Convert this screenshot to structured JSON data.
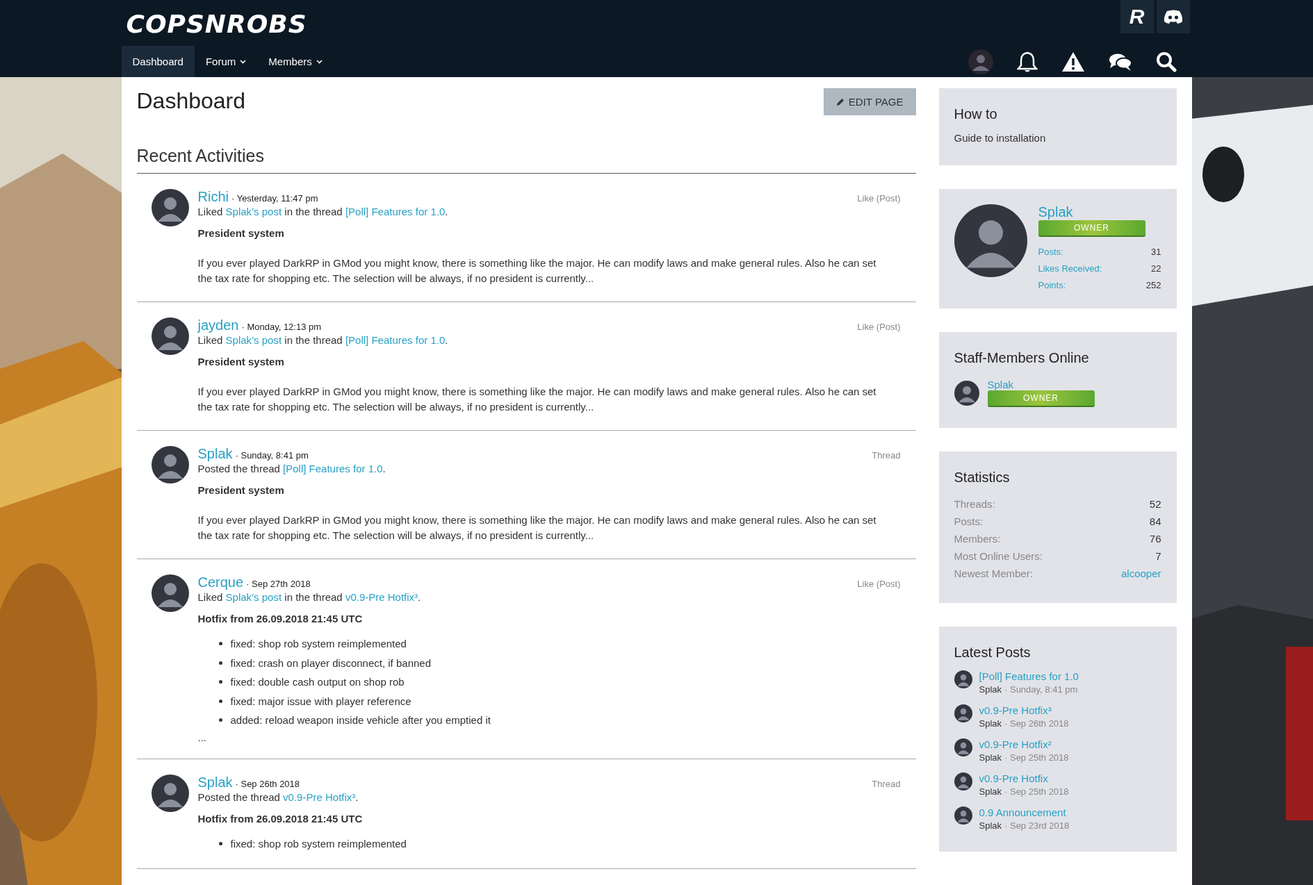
{
  "header": {
    "logo": "COPSNROBS",
    "top_buttons": [
      {
        "kind": "letter",
        "label": "R"
      },
      {
        "kind": "controller"
      }
    ],
    "nav": [
      {
        "label": "Dashboard",
        "selected": true,
        "dropdown": false
      },
      {
        "label": "Forum",
        "selected": false,
        "dropdown": true
      },
      {
        "label": "Members",
        "selected": false,
        "dropdown": true
      }
    ]
  },
  "page": {
    "title": "Dashboard",
    "edit_button": "EDIT PAGE",
    "section_title": "Recent Activities"
  },
  "activities": [
    {
      "user": "Richi",
      "time": "· Yesterday, 11:47 pm",
      "type": "Like (Post)",
      "action": [
        {
          "kind": "text",
          "text": "Liked "
        },
        {
          "kind": "link",
          "text": "Splak’s post"
        },
        {
          "kind": "text",
          "text": " in the thread "
        },
        {
          "kind": "link",
          "text": "[Poll] Features for 1.0"
        },
        {
          "kind": "text",
          "text": "."
        }
      ],
      "title": "President system",
      "excerpt": "If you ever played DarkRP in GMod you might know, there is something like the major. He can modify laws and make general rules. Also he can set the tax rate for shopping etc. The selection will be always, if no president is currently..."
    },
    {
      "user": "jayden",
      "time": "· Monday, 12:13 pm",
      "type": "Like (Post)",
      "action": [
        {
          "kind": "text",
          "text": "Liked "
        },
        {
          "kind": "link",
          "text": "Splak’s post"
        },
        {
          "kind": "text",
          "text": " in the thread "
        },
        {
          "kind": "link",
          "text": "[Poll] Features for 1.0"
        },
        {
          "kind": "text",
          "text": "."
        }
      ],
      "title": "President system",
      "excerpt": "If you ever played DarkRP in GMod you might know, there is something like the major. He can modify laws and make general rules. Also he can set the tax rate for shopping etc. The selection will be always, if no president is currently..."
    },
    {
      "user": "Splak",
      "time": "· Sunday, 8:41 pm",
      "type": "Thread",
      "action": [
        {
          "kind": "text",
          "text": "Posted the thread "
        },
        {
          "kind": "link",
          "text": "[Poll] Features for 1.0"
        },
        {
          "kind": "text",
          "text": "."
        }
      ],
      "title": "President system",
      "excerpt": "If you ever played DarkRP in GMod you might know, there is something like the major. He can modify laws and make general rules. Also he can set the tax rate for shopping etc. The selection will be always, if no president is currently..."
    },
    {
      "user": "Cerque",
      "time": "· Sep 27th 2018",
      "type": "Like (Post)",
      "action": [
        {
          "kind": "text",
          "text": "Liked "
        },
        {
          "kind": "link",
          "text": "Splak’s post"
        },
        {
          "kind": "text",
          "text": " in the thread "
        },
        {
          "kind": "link",
          "text": "v0.9-Pre Hotfix³"
        },
        {
          "kind": "text",
          "text": "."
        }
      ],
      "title": "Hotfix from 26.09.2018 21:45 UTC",
      "bullets": [
        "fixed: shop rob system reimplemented",
        "fixed: crash on player disconnect, if banned",
        "fixed: double cash output on shop rob",
        "fixed: major issue with player reference",
        "added: reload weapon inside vehicle after you emptied it"
      ],
      "more": "..."
    },
    {
      "user": "Splak",
      "time": "· Sep 26th 2018",
      "type": "Thread",
      "action": [
        {
          "kind": "text",
          "text": "Posted the thread "
        },
        {
          "kind": "link",
          "text": "v0.9-Pre Hotfix³"
        },
        {
          "kind": "text",
          "text": "."
        }
      ],
      "title": "Hotfix from 26.09.2018 21:45 UTC",
      "bullets": [
        "fixed: shop rob system reimplemented"
      ]
    }
  ],
  "sidebar": {
    "how_to": {
      "title": "How to",
      "link": "Guide to installation"
    },
    "profile": {
      "name": "Splak",
      "badge": "OWNER",
      "stats": [
        {
          "label": "Posts:",
          "value": "31"
        },
        {
          "label": "Likes Received:",
          "value": "22"
        },
        {
          "label": "Points:",
          "value": "252"
        }
      ]
    },
    "staff_online": {
      "title": "Staff-Members Online",
      "members": [
        {
          "name": "Splak",
          "badge": "OWNER"
        }
      ]
    },
    "statistics": {
      "title": "Statistics",
      "rows": [
        {
          "label": "Threads:",
          "value": "52",
          "kind": "text"
        },
        {
          "label": "Posts:",
          "value": "84",
          "kind": "text"
        },
        {
          "label": "Members:",
          "value": "76",
          "kind": "text"
        },
        {
          "label": "Most Online Users:",
          "value": "7",
          "kind": "text"
        },
        {
          "label": "Newest Member:",
          "value": "alcooper",
          "kind": "link"
        }
      ]
    },
    "latest_posts": {
      "title": "Latest Posts",
      "posts": [
        {
          "title": "[Poll] Features for 1.0",
          "author": "Splak",
          "date": "· Sunday, 8:41 pm"
        },
        {
          "title": "v0.9-Pre Hotfix³",
          "author": "Splak",
          "date": "· Sep 26th 2018"
        },
        {
          "title": "v0.9-Pre Hotfix²",
          "author": "Splak",
          "date": "· Sep 25th 2018"
        },
        {
          "title": "v0.9-Pre Hotfix",
          "author": "Splak",
          "date": "· Sep 25th 2018"
        },
        {
          "title": "0.9 Announcement",
          "author": "Splak",
          "date": "· Sep 23rd 2018"
        }
      ]
    }
  }
}
